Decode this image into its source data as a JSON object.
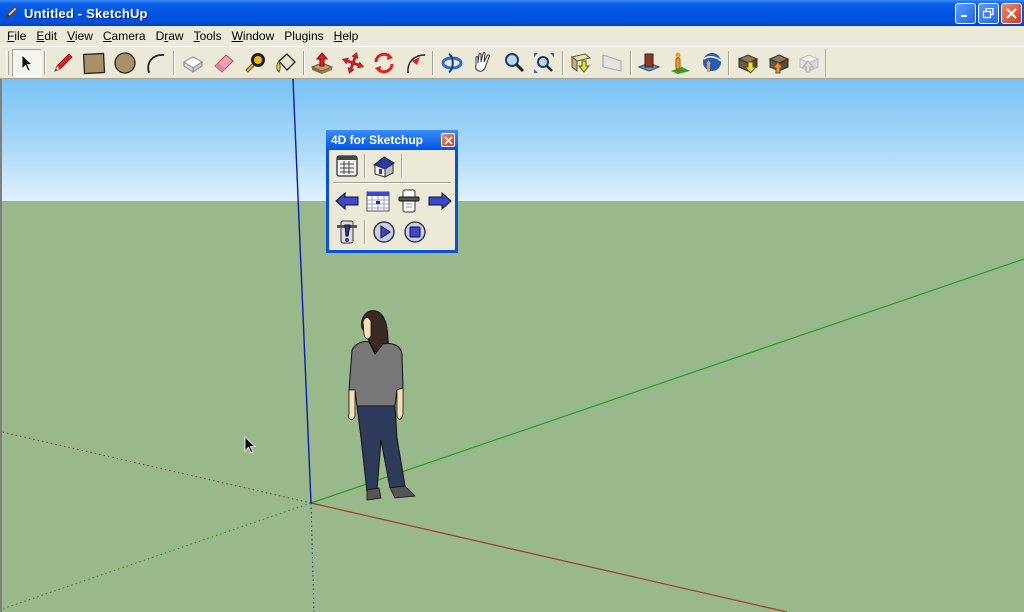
{
  "window": {
    "title": "Untitled - SketchUp",
    "app_icon": "sketchup-pencil-icon",
    "buttons": [
      "minimize",
      "restore",
      "close"
    ]
  },
  "menubar": {
    "items": [
      {
        "label": "File",
        "mnemonic": "F"
      },
      {
        "label": "Edit",
        "mnemonic": "E"
      },
      {
        "label": "View",
        "mnemonic": "V"
      },
      {
        "label": "Camera",
        "mnemonic": "C"
      },
      {
        "label": "Draw",
        "mnemonic": "r"
      },
      {
        "label": "Tools",
        "mnemonic": "T"
      },
      {
        "label": "Window",
        "mnemonic": "W"
      },
      {
        "label": "Plugins",
        "mnemonic": ""
      },
      {
        "label": "Help",
        "mnemonic": "H"
      }
    ]
  },
  "toolbar": {
    "groups": [
      [
        "select"
      ],
      [
        "pencil-line",
        "rectangle",
        "circle",
        "arc"
      ],
      [
        "make-component",
        "eraser",
        "tape-measure",
        "paint-bucket"
      ],
      [
        "push-pull",
        "move",
        "rotate",
        "follow-me"
      ],
      [
        "orbit",
        "pan",
        "zoom",
        "zoom-extents"
      ],
      [
        "get-photo-texture",
        "section-plane"
      ],
      [
        "add-building",
        "add-location",
        "google-earth-toggle"
      ],
      [
        "get-models",
        "share-model",
        "share-component"
      ]
    ],
    "active_tool": "select"
  },
  "viewport": {
    "colors": {
      "sky_top": "#78c3f5",
      "sky_bottom": "#e0f1fd",
      "ground": "#99b98c",
      "axis_red": "#a23a22",
      "axis_green": "#1fa31f",
      "axis_blue": "#0a1ea8"
    },
    "figure": "person-scale-figure"
  },
  "plugin_panel": {
    "title": "4D for Sketchup",
    "row1": [
      "schedule-table",
      "house-model"
    ],
    "row2": [
      "step-back-arrow",
      "calendar",
      "timeline-slider",
      "step-forward-arrow"
    ],
    "row3": [
      "alert-marker",
      "play",
      "stop"
    ]
  }
}
